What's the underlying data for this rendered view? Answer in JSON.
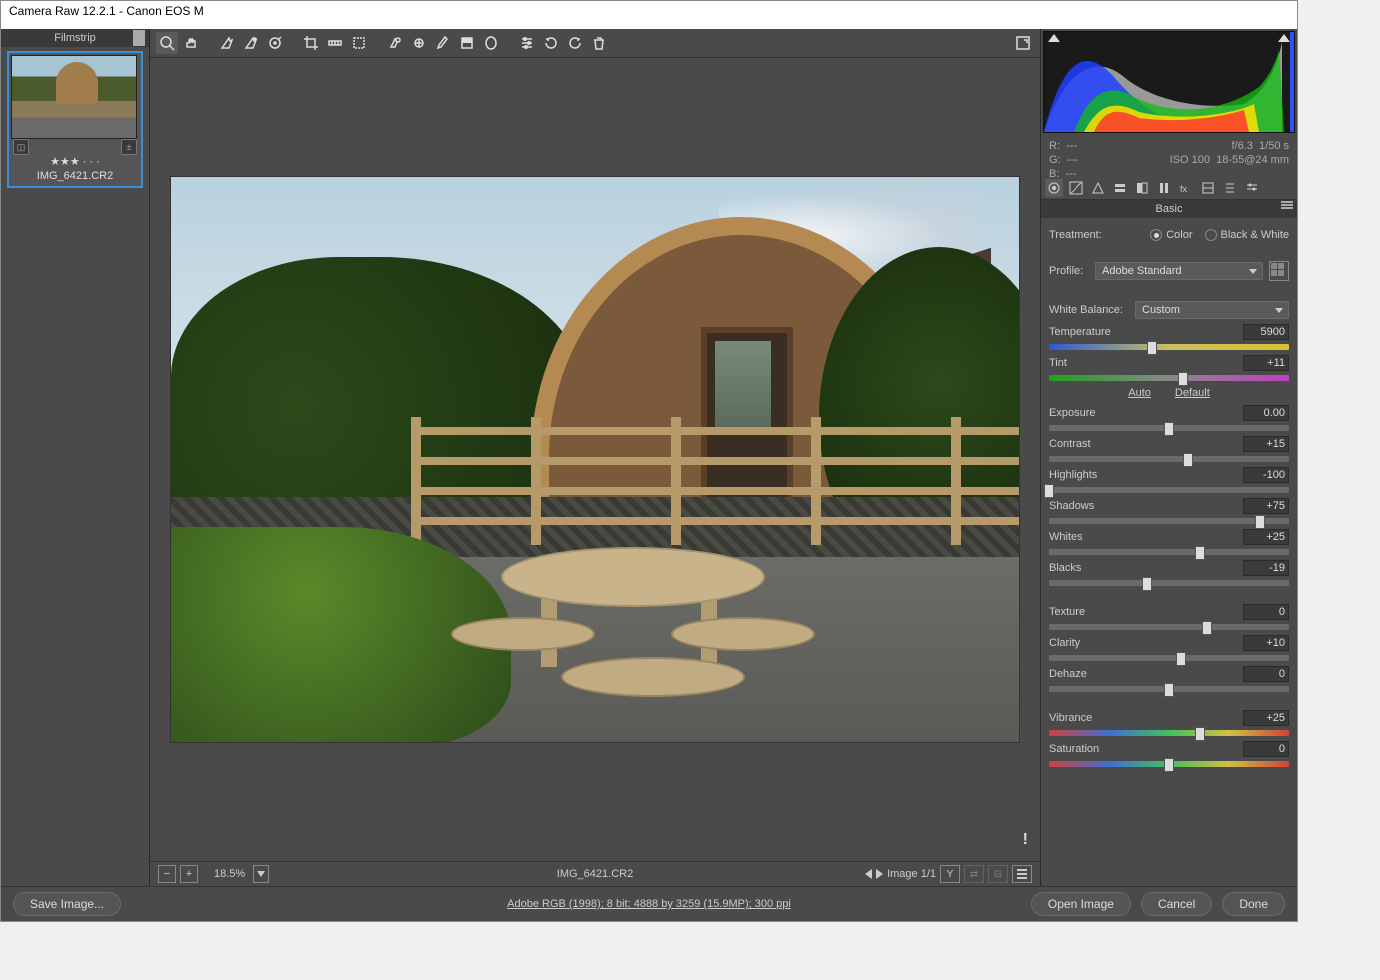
{
  "window_title": "Camera Raw 12.2.1  -  Canon EOS M",
  "filmstrip": {
    "header": "Filmstrip",
    "thumb_rating": "★★★ · · ·",
    "thumb_filename": "IMG_6421.CR2"
  },
  "toolbar": {
    "tools": [
      "zoom",
      "hand",
      "white-balance",
      "color-sampler",
      "target-adjust",
      "crop",
      "straighten",
      "transform",
      "spot-removal",
      "red-eye",
      "adjustment-brush",
      "graduated-filter",
      "radial-filter",
      "snapshots",
      "preferences",
      "rotate-ccw",
      "rotate-cw",
      "delete"
    ]
  },
  "preview": {
    "filename": "IMG_6421.CR2",
    "zoom": "18.5%",
    "image_counter": "Image 1/1"
  },
  "exif": {
    "R": "R:",
    "G": "G:",
    "B": "B:",
    "Rdash": "---",
    "Gdash": "---",
    "Bdash": "---",
    "aperture": "f/6.3",
    "shutter": "1/50 s",
    "iso": "ISO 100",
    "lens": "18-55@24 mm"
  },
  "basic": {
    "panel_title": "Basic",
    "treatment_label": "Treatment:",
    "color_label": "Color",
    "bw_label": "Black & White",
    "profile_label": "Profile:",
    "profile_value": "Adobe Standard",
    "wb_label": "White Balance:",
    "wb_value": "Custom",
    "auto": "Auto",
    "default": "Default",
    "sliders": {
      "temperature": {
        "label": "Temperature",
        "value": "5900",
        "pos": 43,
        "track": "temp"
      },
      "tint": {
        "label": "Tint",
        "value": "+11",
        "pos": 56,
        "track": "tint"
      },
      "exposure": {
        "label": "Exposure",
        "value": "0.00",
        "pos": 50
      },
      "contrast": {
        "label": "Contrast",
        "value": "+15",
        "pos": 58
      },
      "highlights": {
        "label": "Highlights",
        "value": "-100",
        "pos": 0
      },
      "shadows": {
        "label": "Shadows",
        "value": "+75",
        "pos": 88
      },
      "whites": {
        "label": "Whites",
        "value": "+25",
        "pos": 63
      },
      "blacks": {
        "label": "Blacks",
        "value": "-19",
        "pos": 41
      },
      "texture": {
        "label": "Texture",
        "value": "0",
        "pos": 66
      },
      "clarity": {
        "label": "Clarity",
        "value": "+10",
        "pos": 55
      },
      "dehaze": {
        "label": "Dehaze",
        "value": "0",
        "pos": 50
      },
      "vibrance": {
        "label": "Vibrance",
        "value": "+25",
        "pos": 63,
        "track": "vib"
      },
      "saturation": {
        "label": "Saturation",
        "value": "0",
        "pos": 50,
        "track": "vib"
      }
    }
  },
  "footer": {
    "save": "Save Image...",
    "info": "Adobe RGB (1998); 8 bit; 4888 by 3259 (15.9MP); 300 ppi",
    "open": "Open Image",
    "cancel": "Cancel",
    "done": "Done"
  }
}
